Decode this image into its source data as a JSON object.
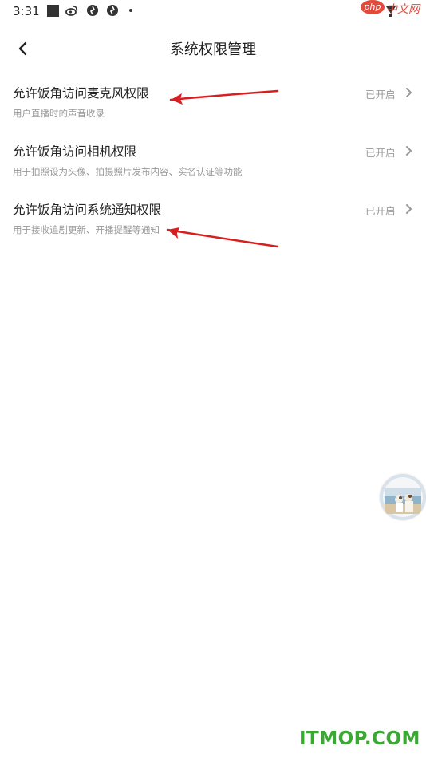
{
  "status_bar": {
    "time": "3:31"
  },
  "watermark_top": {
    "brand": "php",
    "text": "中文网"
  },
  "header": {
    "title": "系统权限管理"
  },
  "permissions": [
    {
      "title": "允许饭角访问麦克风权限",
      "description": "用户直播时的声音收录",
      "status": "已开启"
    },
    {
      "title": "允许饭角访问相机权限",
      "description": "用于拍照设为头像、拍摄照片发布内容、实名认证等功能",
      "status": "已开启"
    },
    {
      "title": "允许饭角访问系统通知权限",
      "description": "用于接收追剧更新、开播提醒等通知",
      "status": "已开启"
    }
  ],
  "watermark_bottom": {
    "text": "ITMOP.COM"
  },
  "colors": {
    "arrow": "#d81e1e",
    "watermark_green": "#3aa832",
    "php_red": "#e24a3b"
  },
  "icons": {
    "back": "chevron-left-icon",
    "row_chevron": "chevron-right-icon",
    "float": "avatar"
  }
}
